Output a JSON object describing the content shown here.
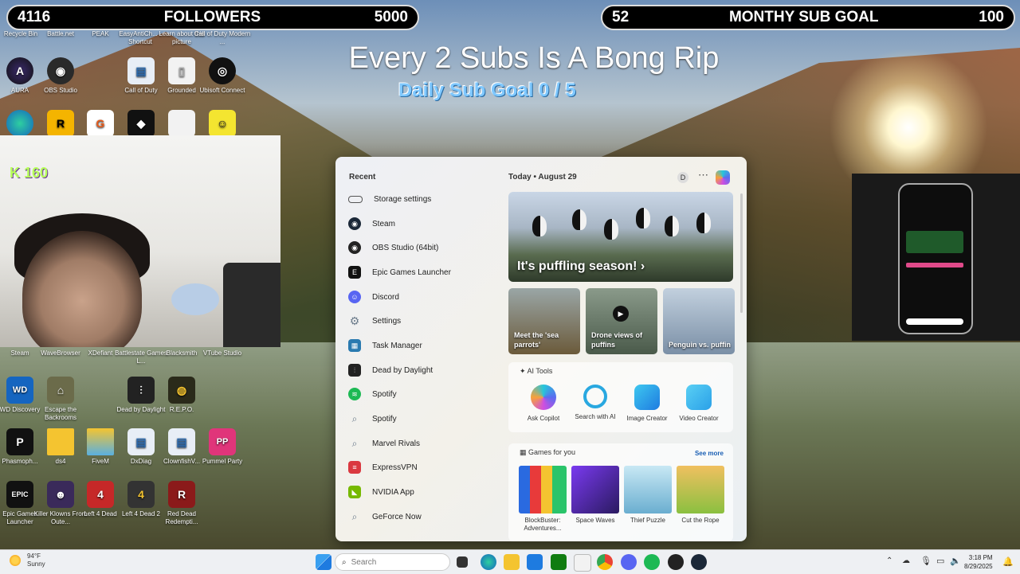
{
  "followers_bar": {
    "current": "4116",
    "label": "FOLLOWERS",
    "goal": "5000"
  },
  "sub_bar": {
    "current": "52",
    "label": "MONTHY SUB GOAL",
    "goal": "100"
  },
  "headline": "Every 2 Subs Is A Bong Rip",
  "daily_goal": "Daily Sub Goal  0 / 5",
  "kick_count": "160",
  "desktop_top_labels": [
    "Recycle Bin",
    "Battle.net",
    "PEAK",
    "EasyAntiCh... - Shortcut",
    "Learn about this picture",
    "Call of Duty Modern ..."
  ],
  "desktop_icons": [
    {
      "label": "AURA",
      "color": "#1b1b3a",
      "glyph": "A"
    },
    {
      "label": "OBS Studio",
      "color": "#2a2a2a",
      "glyph": "◉"
    },
    {
      "label": "Call of Duty",
      "color": "#e8eef6",
      "glyph": "▤"
    },
    {
      "label": "Grounded",
      "color": "#f2f2f2",
      "glyph": "▯"
    },
    {
      "label": "Ubisoft Connect",
      "color": "#111",
      "glyph": "◎"
    },
    {
      "label": "Steam",
      "color": "#1b2838",
      "glyph": ""
    },
    {
      "label": "WaveBrowser",
      "color": "#1b2838",
      "glyph": ""
    },
    {
      "label": "XDefiant",
      "color": "#1b2838",
      "glyph": ""
    },
    {
      "label": "Battlestate Games L...",
      "color": "#1b2838",
      "glyph": ""
    },
    {
      "label": "Blacksmith",
      "color": "#1b2838",
      "glyph": ""
    },
    {
      "label": "VTube Studio",
      "color": "#1b2838",
      "glyph": ""
    },
    {
      "label": "WD Discovery",
      "color": "#1565c0",
      "glyph": "WD"
    },
    {
      "label": "Escape the Backrooms",
      "color": "#6b6b4a",
      "glyph": "⌂"
    },
    {
      "label": "Dead by Daylight",
      "color": "#222",
      "glyph": "⫶"
    },
    {
      "label": "R.E.P.O.",
      "color": "#2a2a1a",
      "glyph": "◍"
    },
    {
      "label": "Phasmoph...",
      "color": "#111",
      "glyph": "P"
    },
    {
      "label": "ds4",
      "color": "#f4c430",
      "glyph": ""
    },
    {
      "label": "FiveM",
      "color": "#f4c430",
      "glyph": ""
    },
    {
      "label": "DxDiag",
      "color": "#e8eef6",
      "glyph": "▤"
    },
    {
      "label": "ClownfishV...",
      "color": "#e8eef6",
      "glyph": "▤"
    },
    {
      "label": "Pummel Party",
      "color": "#e0357a",
      "glyph": "PP"
    },
    {
      "label": "Epic Games Launcher",
      "color": "#111",
      "glyph": "EPIC"
    },
    {
      "label": "Killer Klowns From Oute...",
      "color": "#3a2a5a",
      "glyph": "☻"
    },
    {
      "label": "Left 4 Dead",
      "color": "#c62828",
      "glyph": "4"
    },
    {
      "label": "Left 4 Dead 2",
      "color": "#333",
      "glyph": "4"
    },
    {
      "label": "Red Dead Redempti...",
      "color": "#8b1a1a",
      "glyph": "R"
    }
  ],
  "start_menu": {
    "recent_title": "Recent",
    "recent_items": [
      {
        "label": "Storage settings",
        "color": "#555",
        "glyph": "▭"
      },
      {
        "label": "Steam",
        "color": "#1b2838",
        "glyph": "◉"
      },
      {
        "label": "OBS Studio (64bit)",
        "color": "#222",
        "glyph": "◉"
      },
      {
        "label": "Epic Games Launcher",
        "color": "#111",
        "glyph": "E"
      },
      {
        "label": "Discord",
        "color": "#5865f2",
        "glyph": "☺"
      },
      {
        "label": "Settings",
        "color": "#6a7a8a",
        "glyph": "⚙"
      },
      {
        "label": "Task Manager",
        "color": "#2a7ab0",
        "glyph": "▦"
      },
      {
        "label": "Dead by Daylight",
        "color": "#222",
        "glyph": "⫶"
      },
      {
        "label": "Spotify",
        "color": "#1db954",
        "glyph": "≋"
      },
      {
        "label": "Spotify",
        "color": "#9aa0a8",
        "glyph": "⌕"
      },
      {
        "label": "Marvel Rivals",
        "color": "#9aa0a8",
        "glyph": "⌕"
      },
      {
        "label": "ExpressVPN",
        "color": "#da3940",
        "glyph": "≡"
      },
      {
        "label": "NVIDIA App",
        "color": "#76b900",
        "glyph": "◣"
      },
      {
        "label": "GeForce Now",
        "color": "#9aa0a8",
        "glyph": "⌕"
      }
    ],
    "today_label": "Today  •  August 29",
    "user_initial": "D",
    "hero_title": "It's puffling season! ›",
    "cards": [
      {
        "title": "Meet the 'sea parrots'",
        "color": "#6b5a3a"
      },
      {
        "title": "Drone views of puffins",
        "color": "#5a6a5a"
      },
      {
        "title": "Penguin vs. puffin",
        "color": "#7a8fa6"
      }
    ],
    "ai_tools_title": "AI Tools",
    "ai_tools": [
      {
        "label": "Ask Copilot",
        "color": "#5b6cf0"
      },
      {
        "label": "Search with AI",
        "color": "#29a8e0"
      },
      {
        "label": "Image Creator",
        "color": "#1e9be0"
      },
      {
        "label": "Video Creator",
        "color": "#2aa0e8"
      }
    ],
    "games_title": "Games for you",
    "see_more": "See more",
    "games": [
      {
        "label": "BlockBuster: Adventures...",
        "color": "#1f3a8a"
      },
      {
        "label": "Space Waves",
        "color": "#4a2aa0"
      },
      {
        "label": "Thief Puzzle",
        "color": "#9ad0e8"
      },
      {
        "label": "Cut the Rope",
        "color": "#c78a3a"
      }
    ]
  },
  "taskbar": {
    "temperature": "94°F",
    "condition": "Sunny",
    "search_placeholder": "Search",
    "time": "3:18 PM",
    "date": "8/29/2025"
  }
}
